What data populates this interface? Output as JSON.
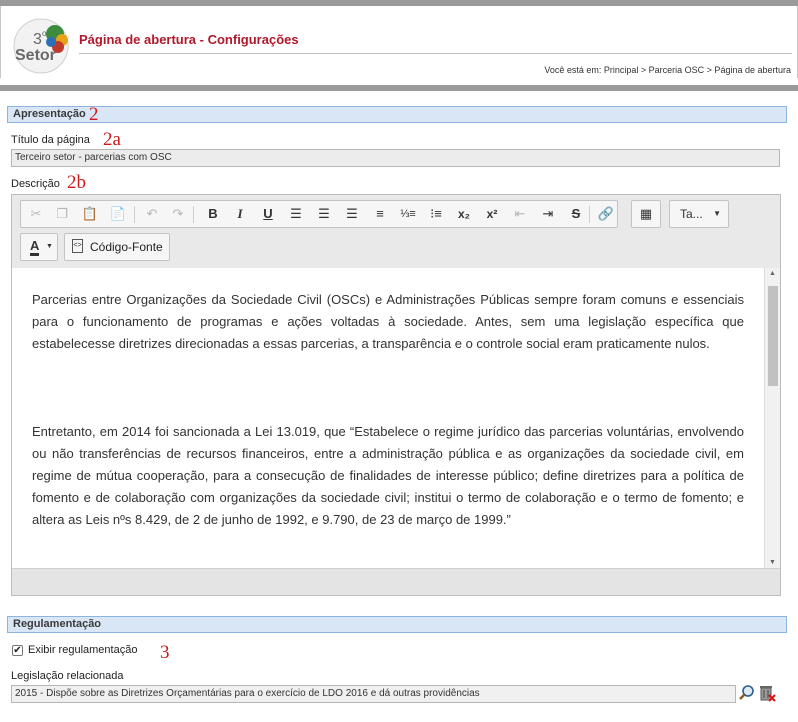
{
  "header": {
    "logo_text": "3º Setor",
    "title": "Página de abertura - Configurações",
    "breadcrumb": "Você está em: Principal > Parceria OSC > Página de abertura"
  },
  "apresentacao": {
    "section_title": "Apresentação",
    "annotation": "2",
    "titulo_label": "Título da página",
    "titulo_annotation": "2a",
    "titulo_value": "Terceiro setor - parcerias com OSC",
    "descricao_label": "Descrição",
    "descricao_annotation": "2b"
  },
  "editor": {
    "toolbar_row1": [
      "cut",
      "copy",
      "paste",
      "paste-text",
      "undo",
      "redo",
      "bold",
      "italic",
      "underline",
      "align-left",
      "align-center",
      "align-right",
      "justify",
      "ordered-list",
      "bullet-list",
      "subscript",
      "superscript",
      "outdent",
      "indent",
      "strikethrough",
      "link",
      "table"
    ],
    "font_size_label": "Ta...",
    "text_color_label": "A",
    "source_button_label": "Código-Fonte",
    "paragraph1": "Parcerias entre Organizações da Sociedade Civil (OSCs) e Administrações Públicas sempre foram comuns e essenciais para o funcionamento de programas e ações voltadas à sociedade. Antes, sem uma legislação específica que estabelecesse diretrizes direcionadas a essas parcerias, a transparência e o controle social eram praticamente nulos.",
    "paragraph2": "Entretanto, em 2014 foi sancionada a Lei 13.019, que “Estabelece o regime jurídico das parcerias voluntárias, envolvendo ou não transferências de recursos financeiros, entre a administração pública e as organizações da sociedade civil, em regime de mútua cooperação, para a consecução de finalidades de interesse público; define diretrizes para a política de fomento e de colaboração com organizações da sociedade civil; institui o termo de colaboração e o termo de fomento; e altera as Leis nºs 8.429, de 2 de junho de 1992, e 9.790, de 23 de março de 1999.”"
  },
  "regulamentacao": {
    "section_title": "Regulamentação",
    "checkbox_label": "Exibir regulamentação",
    "checkbox_checked": true,
    "annotation": "3",
    "legislacao_label": "Legislação relacionada",
    "legislacao_value": "2015 - Dispõe sobre as Diretrizes Orçamentárias para o exercício de LDO 2016 e dá outras providências"
  },
  "colors": {
    "accent_red": "#b0182b",
    "section_bg": "#d8e6f6",
    "annotation_red": "#cc1a1a"
  }
}
